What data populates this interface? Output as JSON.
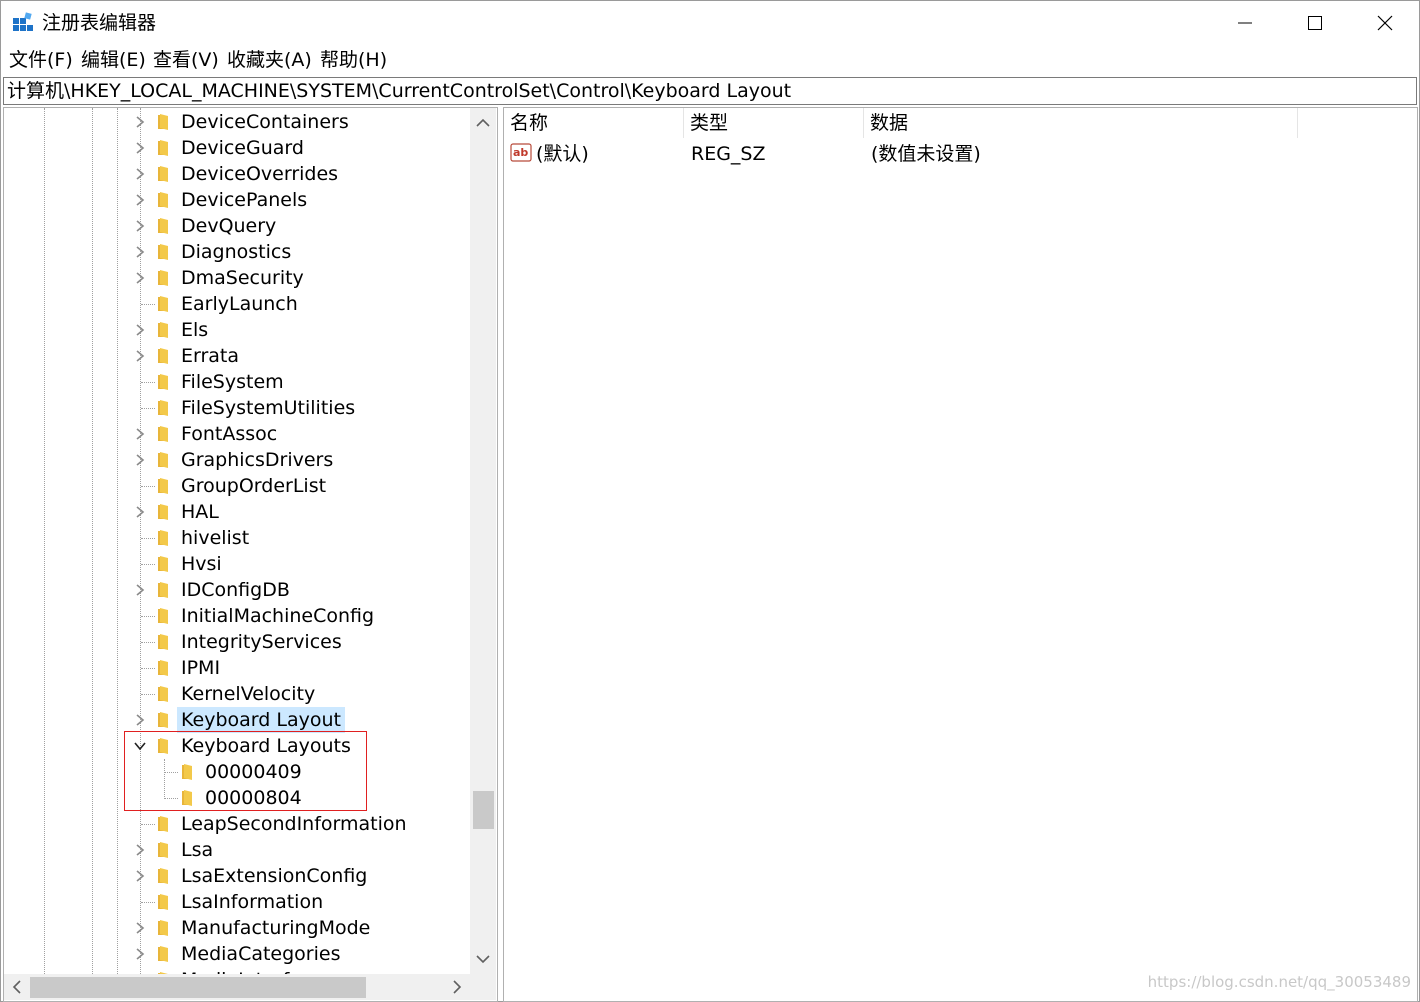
{
  "window": {
    "title": "注册表编辑器",
    "controls": [
      "minimize",
      "maximize",
      "close"
    ]
  },
  "menu": [
    "文件(F)",
    "编辑(E)",
    "查看(V)",
    "收藏夹(A)",
    "帮助(H)"
  ],
  "address": "计算机\\HKEY_LOCAL_MACHINE\\SYSTEM\\CurrentControlSet\\Control\\Keyboard Layout",
  "tree": {
    "items": [
      {
        "label": "DeviceContainers",
        "expander": "collapsed",
        "level": 0
      },
      {
        "label": "DeviceGuard",
        "expander": "collapsed",
        "level": 0
      },
      {
        "label": "DeviceOverrides",
        "expander": "collapsed",
        "level": 0
      },
      {
        "label": "DevicePanels",
        "expander": "collapsed",
        "level": 0
      },
      {
        "label": "DevQuery",
        "expander": "collapsed",
        "level": 0
      },
      {
        "label": "Diagnostics",
        "expander": "collapsed",
        "level": 0
      },
      {
        "label": "DmaSecurity",
        "expander": "collapsed",
        "level": 0
      },
      {
        "label": "EarlyLaunch",
        "expander": "none",
        "level": 0
      },
      {
        "label": "Els",
        "expander": "collapsed",
        "level": 0
      },
      {
        "label": "Errata",
        "expander": "collapsed",
        "level": 0
      },
      {
        "label": "FileSystem",
        "expander": "none",
        "level": 0
      },
      {
        "label": "FileSystemUtilities",
        "expander": "none",
        "level": 0
      },
      {
        "label": "FontAssoc",
        "expander": "collapsed",
        "level": 0
      },
      {
        "label": "GraphicsDrivers",
        "expander": "collapsed",
        "level": 0
      },
      {
        "label": "GroupOrderList",
        "expander": "none",
        "level": 0
      },
      {
        "label": "HAL",
        "expander": "collapsed",
        "level": 0
      },
      {
        "label": "hivelist",
        "expander": "none",
        "level": 0
      },
      {
        "label": "Hvsi",
        "expander": "none",
        "level": 0
      },
      {
        "label": "IDConfigDB",
        "expander": "collapsed",
        "level": 0
      },
      {
        "label": "InitialMachineConfig",
        "expander": "none",
        "level": 0
      },
      {
        "label": "IntegrityServices",
        "expander": "none",
        "level": 0
      },
      {
        "label": "IPMI",
        "expander": "none",
        "level": 0
      },
      {
        "label": "KernelVelocity",
        "expander": "none",
        "level": 0
      },
      {
        "label": "Keyboard Layout",
        "expander": "collapsed",
        "level": 0,
        "selected": true
      },
      {
        "label": "Keyboard Layouts",
        "expander": "expanded",
        "level": 0
      },
      {
        "label": "00000409",
        "expander": "none",
        "level": 1
      },
      {
        "label": "00000804",
        "expander": "none",
        "level": 1
      },
      {
        "label": "LeapSecondInformation",
        "expander": "none",
        "level": 0
      },
      {
        "label": "Lsa",
        "expander": "collapsed",
        "level": 0
      },
      {
        "label": "LsaExtensionConfig",
        "expander": "collapsed",
        "level": 0
      },
      {
        "label": "LsaInformation",
        "expander": "none",
        "level": 0
      },
      {
        "label": "ManufacturingMode",
        "expander": "collapsed",
        "level": 0
      },
      {
        "label": "MediaCategories",
        "expander": "collapsed",
        "level": 0
      },
      {
        "label": "MediaInterfaces",
        "expander": "collapsed",
        "level": 0
      }
    ]
  },
  "list": {
    "columns": [
      "名称",
      "类型",
      "数据"
    ],
    "rows": [
      {
        "icon": "string-value-icon",
        "name": "(默认)",
        "type": "REG_SZ",
        "data": "(数值未设置)"
      }
    ]
  },
  "watermark": "https://blog.csdn.net/qq_30053489",
  "colors": {
    "selection": "#cce8ff",
    "highlight_box": "#e02020",
    "folder": "#f3c94a"
  }
}
